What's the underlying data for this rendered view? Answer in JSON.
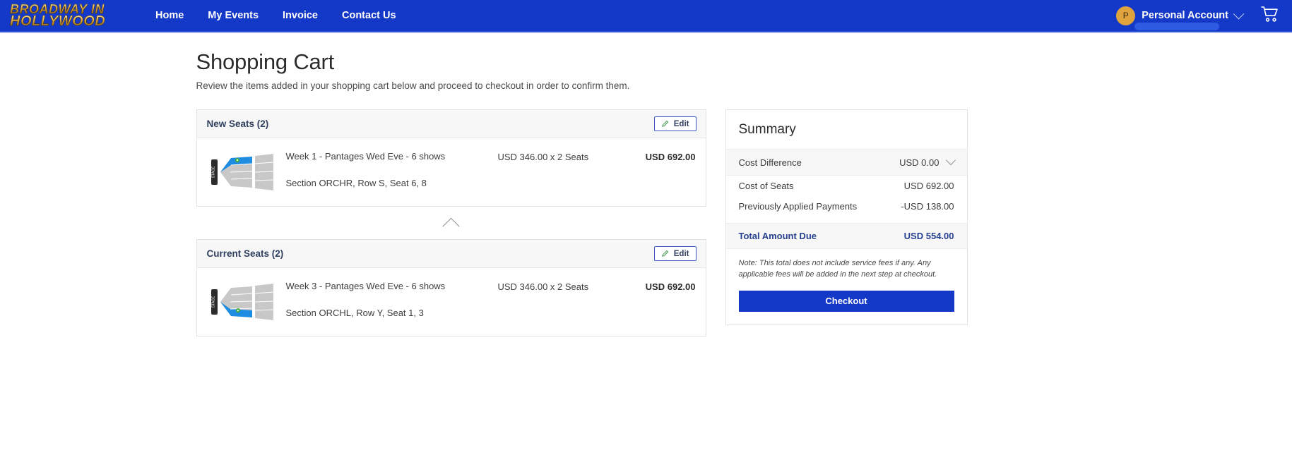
{
  "nav": {
    "brand_line1": "BROADWAY IN",
    "brand_line2": "HOLLYWOOD",
    "links": [
      {
        "label": "Home"
      },
      {
        "label": "My Events"
      },
      {
        "label": "Invoice"
      },
      {
        "label": "Contact Us"
      }
    ],
    "account": {
      "avatar_initial": "P",
      "name": "Personal Account",
      "chevron_icon": "chevron-down-icon",
      "redacted": true
    },
    "cart_icon": "shopping-cart-icon"
  },
  "page": {
    "title": "Shopping Cart",
    "subtitle": "Review the items added in your shopping cart below and proceed to checkout in order to confirm them."
  },
  "cards": [
    {
      "header": "New Seats (2)",
      "edit_label": "Edit",
      "edit_icon": "pencil-icon",
      "seatmap_icon": "theater-seatmap-thumbnail",
      "item_name": "Week 1 - Pantages Wed Eve - 6 shows",
      "item_seat": "Section ORCHR, Row S, Seat 6, 8",
      "unit_price": "USD 346.00 x 2 Seats",
      "total_price": "USD 692.00"
    },
    {
      "header": "Current Seats (2)",
      "edit_label": "Edit",
      "edit_icon": "pencil-icon",
      "seatmap_icon": "theater-seatmap-thumbnail",
      "item_name": "Week 3 - Pantages Wed Eve - 6 shows",
      "item_seat": "Section ORCHL, Row Y, Seat 1, 3",
      "unit_price": "USD 346.00 x 2 Seats",
      "total_price": "USD 692.00"
    }
  ],
  "collapse_toggle_icon": "chevron-up-icon",
  "summary": {
    "title": "Summary",
    "cost_difference_label": "Cost Difference",
    "cost_difference_value": "USD 0.00",
    "cost_difference_chevron": "chevron-down-icon",
    "rows": [
      {
        "label": "Cost of Seats",
        "value": "USD 692.00"
      },
      {
        "label": "Previously Applied Payments",
        "value": "-USD 138.00"
      }
    ],
    "total_label": "Total Amount Due",
    "total_value": "USD 554.00",
    "note": "Note: This total does not include service fees if any. Any applicable fees will be added in the next step at checkout.",
    "checkout_label": "Checkout"
  },
  "colors": {
    "brand_blue": "#1438c8",
    "accent_navy": "#27408f",
    "avatar_gold": "#e0a33e",
    "seatmap_blue": "#1e8ce0",
    "marker_green": "#3fae3f"
  }
}
